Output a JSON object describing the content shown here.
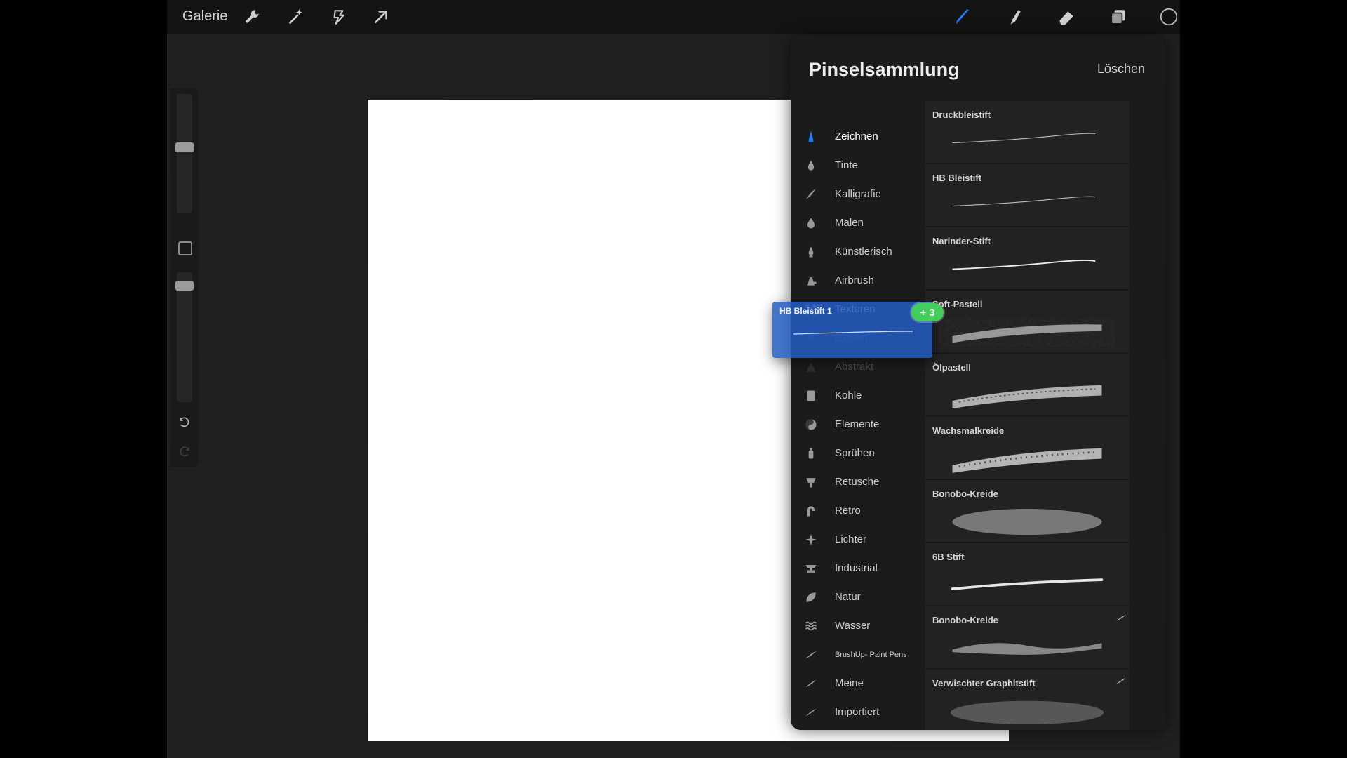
{
  "topbar": {
    "gallery": "Galerie",
    "tools_left": [
      "wrench-icon",
      "magic-wand-icon",
      "selection-icon",
      "transform-arrow-icon"
    ],
    "tools_right": [
      "brush-icon",
      "smudge-icon",
      "eraser-icon",
      "layers-icon",
      "color-swatch-icon"
    ],
    "accent": "#1f7bff",
    "color_swatch": "#111111"
  },
  "panel": {
    "title": "Pinselsammlung",
    "delete_label": "Löschen",
    "sets": [
      {
        "label": "Zeichnen",
        "icon": "pencil-tip-icon",
        "active": true
      },
      {
        "label": "Tinte",
        "icon": "ink-drop-icon"
      },
      {
        "label": "Kalligrafie",
        "icon": "calligraphy-icon"
      },
      {
        "label": "Malen",
        "icon": "paint-drop-icon"
      },
      {
        "label": "Künstlerisch",
        "icon": "artistic-drop-icon"
      },
      {
        "label": "Airbrush",
        "icon": "airbrush-icon"
      },
      {
        "label": "Texturen",
        "icon": "texture-icon"
      },
      {
        "label": "Exoten",
        "icon": "abstract-icon"
      },
      {
        "label": "Abstrakt",
        "icon": "abstract2-icon"
      },
      {
        "label": "Kohle",
        "icon": "charcoal-icon"
      },
      {
        "label": "Elemente",
        "icon": "yin-yang-icon"
      },
      {
        "label": "Sprühen",
        "icon": "spray-can-icon"
      },
      {
        "label": "Retusche",
        "icon": "retouch-icon"
      },
      {
        "label": "Retro",
        "icon": "retro-icon"
      },
      {
        "label": "Lichter",
        "icon": "sparkle-icon"
      },
      {
        "label": "Industrial",
        "icon": "anvil-icon"
      },
      {
        "label": "Natur",
        "icon": "leaf-icon"
      },
      {
        "label": "Wasser",
        "icon": "waves-icon"
      },
      {
        "label": "BrushUp- Paint Pens",
        "icon": "stroke-icon",
        "small": true
      },
      {
        "label": "Meine",
        "icon": "stroke-icon"
      },
      {
        "label": "Importiert",
        "icon": "stroke-icon"
      }
    ],
    "brushes": [
      {
        "name": "Druckbleistift",
        "style": "thin"
      },
      {
        "name": "HB Bleistift",
        "style": "thin"
      },
      {
        "name": "Narinder-Stift",
        "style": "thin-bright"
      },
      {
        "name": "Soft-Pastell",
        "style": "pastel"
      },
      {
        "name": "Ölpastell",
        "style": "oil"
      },
      {
        "name": "Wachsmalkreide",
        "style": "crayon"
      },
      {
        "name": "Bonobo-Kreide",
        "style": "chalk"
      },
      {
        "name": "6B Stift",
        "style": "medium"
      },
      {
        "name": "Bonobo-Kreide",
        "style": "chalk2",
        "imported": true
      },
      {
        "name": "Verwischter Graphitstift",
        "style": "smudge",
        "imported": true
      }
    ]
  },
  "drag": {
    "name": "HB Bleistift 1",
    "badge": "+ 3",
    "badge_color": "#3fcf5a",
    "card_color": "#2a63c9"
  }
}
